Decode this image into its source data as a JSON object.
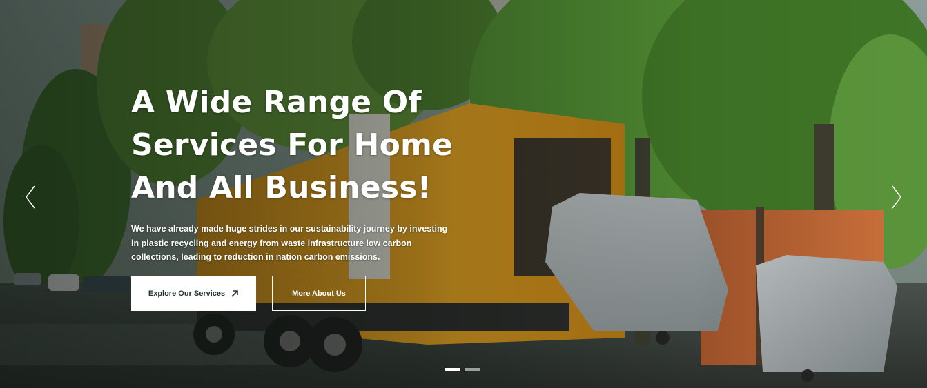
{
  "hero": {
    "headline_lines": [
      "A Wide Range Of",
      "Services For Home",
      "And All Business!"
    ],
    "subtitle_lines": [
      "We have already made huge strides in our sustainability journey by investing",
      "in plastic recycling and energy from waste infrastructure low carbon",
      "collections, leading to reduction in nation carbon emissions."
    ],
    "primary_button": "Explore Our Services",
    "secondary_button": "More About Us",
    "background_image": "garbage-truck-street",
    "slides": {
      "count": 2,
      "active": 1
    }
  },
  "icons": {
    "primary_button_icon": "arrow-up-right-icon",
    "prev": "chevron-left-icon",
    "next": "chevron-right-icon"
  },
  "colors": {
    "button_text": "#23342a",
    "white": "#ffffff",
    "truck": "#e8a320"
  }
}
